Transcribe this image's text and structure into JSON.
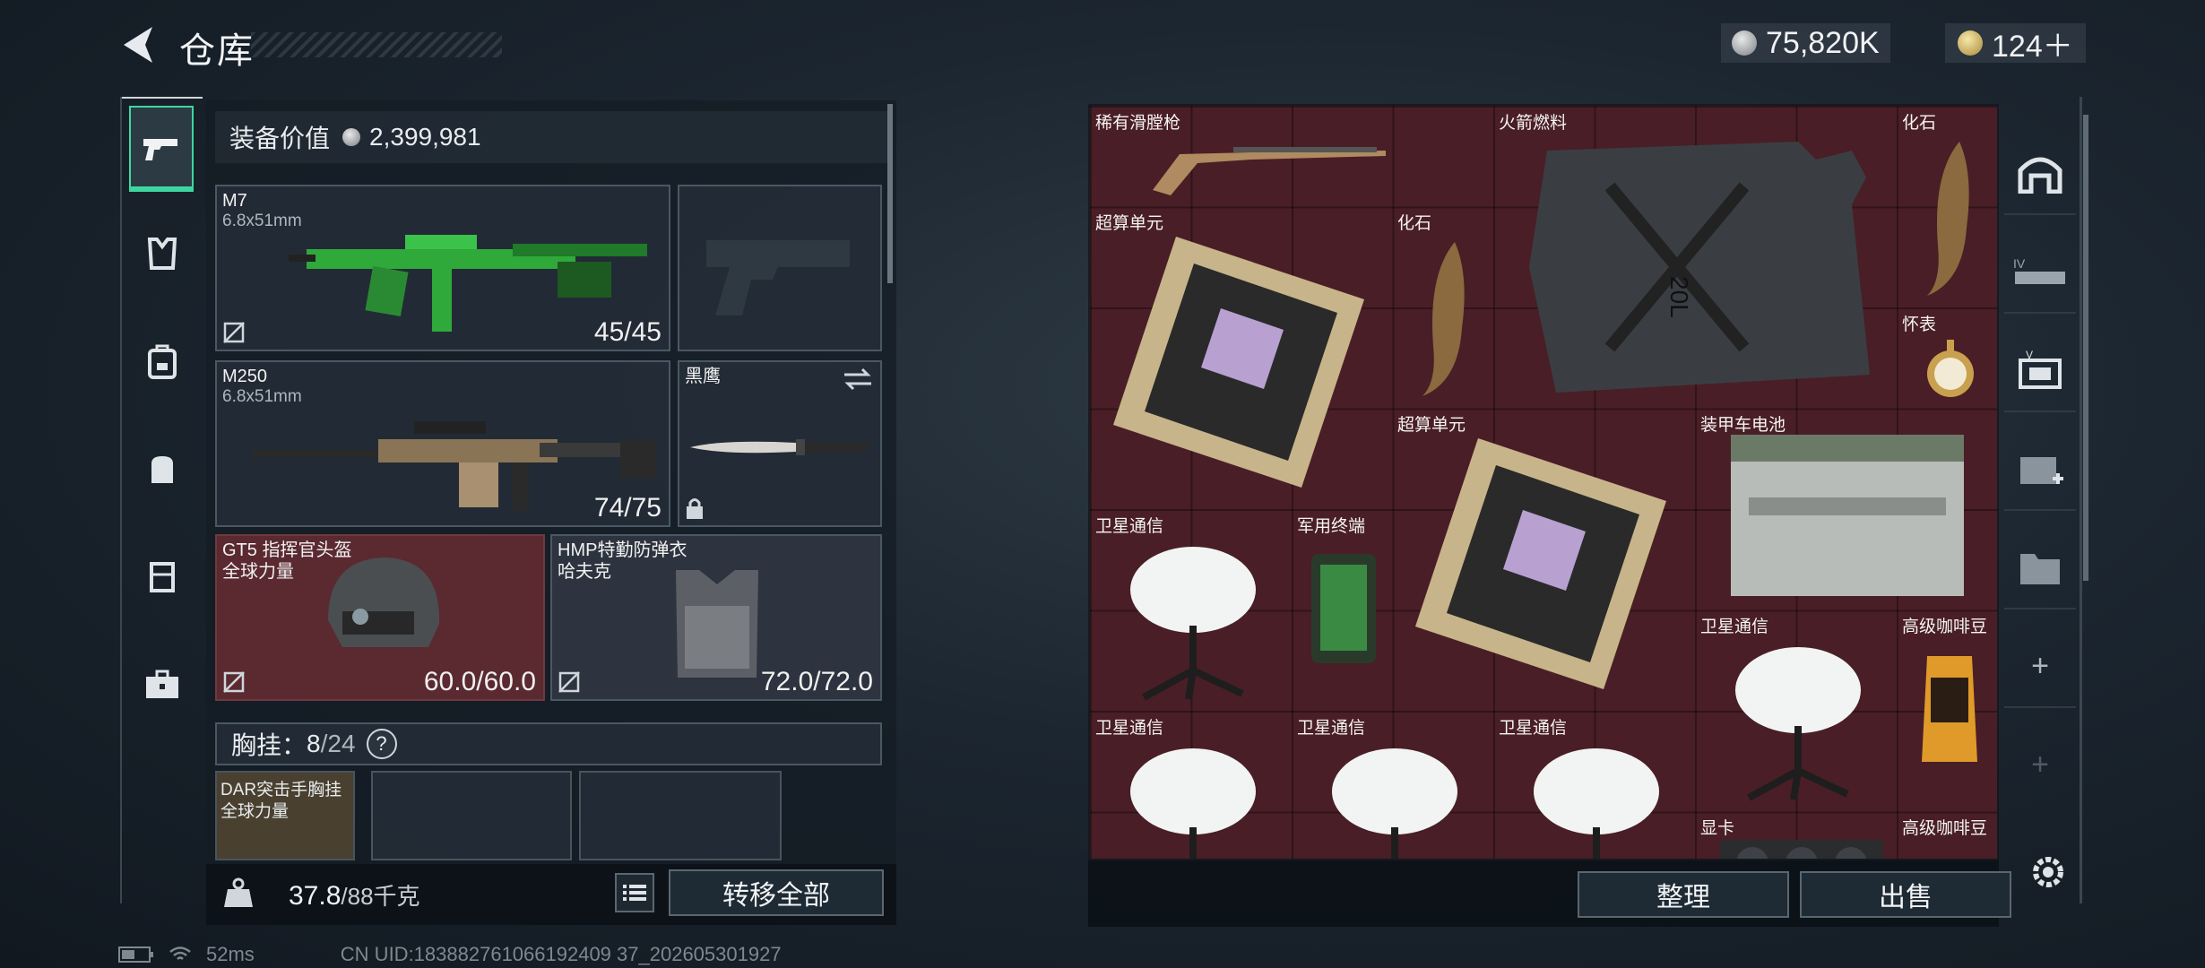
{
  "header": {
    "title": "仓库",
    "currency1": "75,820K",
    "currency2": "124＋"
  },
  "sidebar": {
    "items": [
      "pistol-icon",
      "armor-icon",
      "backpack-icon",
      "bag-icon",
      "vest-icon",
      "toolbox-icon"
    ]
  },
  "equipment": {
    "value_label": "装备价值",
    "value": "2,399,981",
    "primary": {
      "name": "M7",
      "caliber": "6.8x51mm",
      "ammo": "45/45"
    },
    "secondary": {
      "name": "M250",
      "caliber": "6.8x51mm",
      "ammo": "74/75"
    },
    "melee": {
      "name": "黑鹰"
    },
    "helmet": {
      "name": "GT5 指挥官头盔",
      "brand": "全球力量",
      "durability": "60.0/60.0"
    },
    "armor": {
      "name": "HMP特勤防弹衣",
      "brand": "哈夫克",
      "durability": "72.0/72.0"
    },
    "chest": {
      "label": "胸挂：",
      "count": "8",
      "capacity": "/24",
      "help": "?",
      "item_name": "DAR突击手胸挂",
      "item_brand": "全球力量"
    }
  },
  "weight": {
    "current": "37.8",
    "max": "/88千克"
  },
  "buttons": {
    "transfer_all": "转移全部",
    "sort": "整理",
    "sell": "出售"
  },
  "storage": {
    "items": [
      {
        "label": "稀有滑膛枪"
      },
      {
        "label": "火箭燃料"
      },
      {
        "label": "化石"
      },
      {
        "label": "超算单元"
      },
      {
        "label": "化石"
      },
      {
        "label": "怀表"
      },
      {
        "label": "超算单元"
      },
      {
        "label": "装甲车电池"
      },
      {
        "label": "卫星通信"
      },
      {
        "label": "军用终端"
      },
      {
        "label": "卫星通信"
      },
      {
        "label": "高级咖啡豆"
      },
      {
        "label": "卫星通信"
      },
      {
        "label": "卫星通信"
      },
      {
        "label": "卫星通信"
      },
      {
        "label": "显卡"
      },
      {
        "label": "高级咖啡豆"
      }
    ],
    "jerrycan_text": "20L"
  },
  "rail": {
    "items": [
      "shelter-icon",
      "vehicle-icon",
      "case-icon",
      "medkit-icon",
      "folder-icon"
    ],
    "add": "+"
  },
  "footer": {
    "ping": "52ms",
    "uid": "CN UID:183882761066192409 37_202605301927"
  }
}
